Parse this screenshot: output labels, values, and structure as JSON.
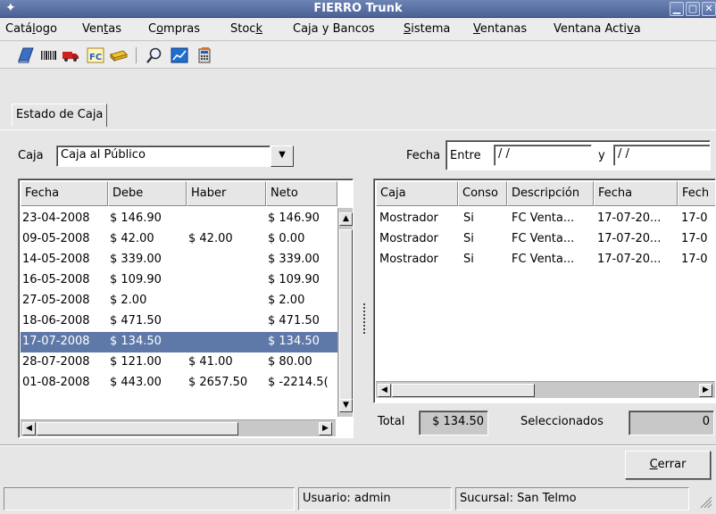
{
  "window": {
    "title": "FIERRO Trunk"
  },
  "menu": [
    {
      "label": "Catálogo",
      "pre": "Catá",
      "key": "l",
      "post": "ogo"
    },
    {
      "label": "Ventas",
      "pre": "Ven",
      "key": "t",
      "post": "as"
    },
    {
      "label": "Compras",
      "pre": "C",
      "key": "o",
      "post": "mpras"
    },
    {
      "label": "Stock",
      "pre": "Stoc",
      "key": "k",
      "post": ""
    },
    {
      "label": "Caja y Bancos",
      "pre": "Ca",
      "key": "j",
      "post": "a y Bancos"
    },
    {
      "label": "Sistema",
      "pre": "",
      "key": "S",
      "post": "istema"
    },
    {
      "label": "Ventanas",
      "pre": "",
      "key": "V",
      "post": "entanas"
    },
    {
      "label": "Ventana Activa",
      "pre": "Ventana Acti",
      "key": "v",
      "post": "a"
    }
  ],
  "toolbar": [
    "book-icon",
    "barcode-icon",
    "truck-icon",
    "invoice-fc-icon",
    "cash-icon",
    "search-icon",
    "chart-icon",
    "calculator-icon"
  ],
  "toolbar_fc_text": "FC",
  "tab": {
    "label": "Estado de Caja"
  },
  "caja": {
    "label": "Caja",
    "value": "Caja al Público"
  },
  "fecha": {
    "label": "Fecha",
    "entre": "Entre",
    "from": "  /  /",
    "y": "y",
    "to": "  /  /"
  },
  "left_table": {
    "columns": [
      "Fecha",
      "Debe",
      "Haber",
      "Neto"
    ],
    "rows": [
      [
        "23-04-2008",
        "$ 146.90",
        "",
        "$ 146.90"
      ],
      [
        "09-05-2008",
        "$ 42.00",
        "$ 42.00",
        "$ 0.00"
      ],
      [
        "14-05-2008",
        "$ 339.00",
        "",
        "$ 339.00"
      ],
      [
        "16-05-2008",
        "$ 109.90",
        "",
        "$ 109.90"
      ],
      [
        "27-05-2008",
        "$ 2.00",
        "",
        "$ 2.00"
      ],
      [
        "18-06-2008",
        "$ 471.50",
        "",
        "$ 471.50"
      ],
      [
        "17-07-2008",
        "$ 134.50",
        "",
        "$ 134.50"
      ],
      [
        "28-07-2008",
        "$ 121.00",
        "$ 41.00",
        "$ 80.00"
      ],
      [
        "01-08-2008",
        "$ 443.00",
        "$ 2657.50",
        "$ -2214.5("
      ]
    ],
    "selected_row": 6
  },
  "right_table": {
    "columns": [
      "Caja",
      "Conso",
      "Descripción",
      "Fecha",
      "Fech"
    ],
    "rows": [
      [
        "Mostrador",
        "Si",
        "FC Venta...",
        "17-07-20...",
        "17-0"
      ],
      [
        "Mostrador",
        "Si",
        "FC Venta...",
        "17-07-20...",
        "17-0"
      ],
      [
        "Mostrador",
        "Si",
        "FC Venta...",
        "17-07-20...",
        "17-0"
      ]
    ]
  },
  "totals": {
    "total_label": "Total",
    "total_value": "$ 134.50",
    "sel_label": "Seleccionados",
    "sel_value": "0"
  },
  "buttons": {
    "close_pre": "",
    "close_key": "C",
    "close_post": "errar"
  },
  "status": {
    "empty": "",
    "user": "Usuario: admin",
    "branch": "Sucursal: San Telmo"
  }
}
